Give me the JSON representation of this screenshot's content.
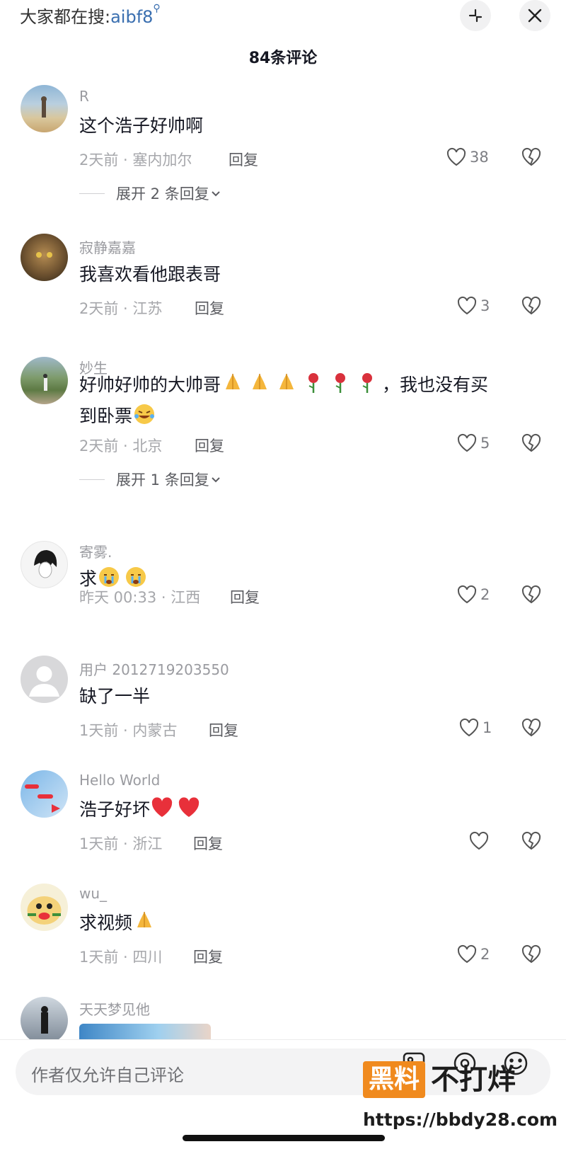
{
  "header": {
    "search_prefix": "大家都在搜:",
    "search_keyword": "aibf8",
    "comment_count": "84条评论"
  },
  "comments": [
    {
      "user": "R",
      "text": "这个浩子好帅啊",
      "time": "2天前 · 塞内加尔",
      "reply": "回复",
      "likes": "38",
      "expand": "展开 2 条回复"
    },
    {
      "user": "寂静嘉嘉",
      "text": "我喜欢看他跟表哥",
      "time": "2天前 · 江苏",
      "reply": "回复",
      "likes": "3"
    },
    {
      "user": "妙生",
      "text_a": "好帅好帅的大帅哥",
      "text_b": "，我也没有买",
      "text_c": "到卧票",
      "time": "2天前 · 北京",
      "reply": "回复",
      "likes": "5",
      "expand": "展开 1 条回复"
    },
    {
      "user": "寄雾.",
      "text": "求",
      "time": "昨天 00:33 · 江西",
      "reply": "回复",
      "likes": "2"
    },
    {
      "user": "用户 2012719203550",
      "text": "缺了一半",
      "time": "1天前 · 内蒙古",
      "reply": "回复",
      "likes": "1"
    },
    {
      "user": "Hello World",
      "text": "浩子好坏",
      "time": "1天前 · 浙江",
      "reply": "回复",
      "likes": ""
    },
    {
      "user": "wu_",
      "text": "求视频",
      "time": "1天前 · 四川",
      "reply": "回复",
      "likes": "2"
    },
    {
      "user": "天天梦见他"
    }
  ],
  "input": {
    "placeholder": "作者仅允许自己评论"
  },
  "watermark": {
    "badge": "黑料",
    "name": "不打烊",
    "url": "https://bbdy28.com"
  },
  "colors": {
    "accent_link": "#3a6fb0",
    "watermark_orange": "#f08a1e",
    "emoji_heart": "#e8303a",
    "emoji_pray": "#f4b63c"
  }
}
